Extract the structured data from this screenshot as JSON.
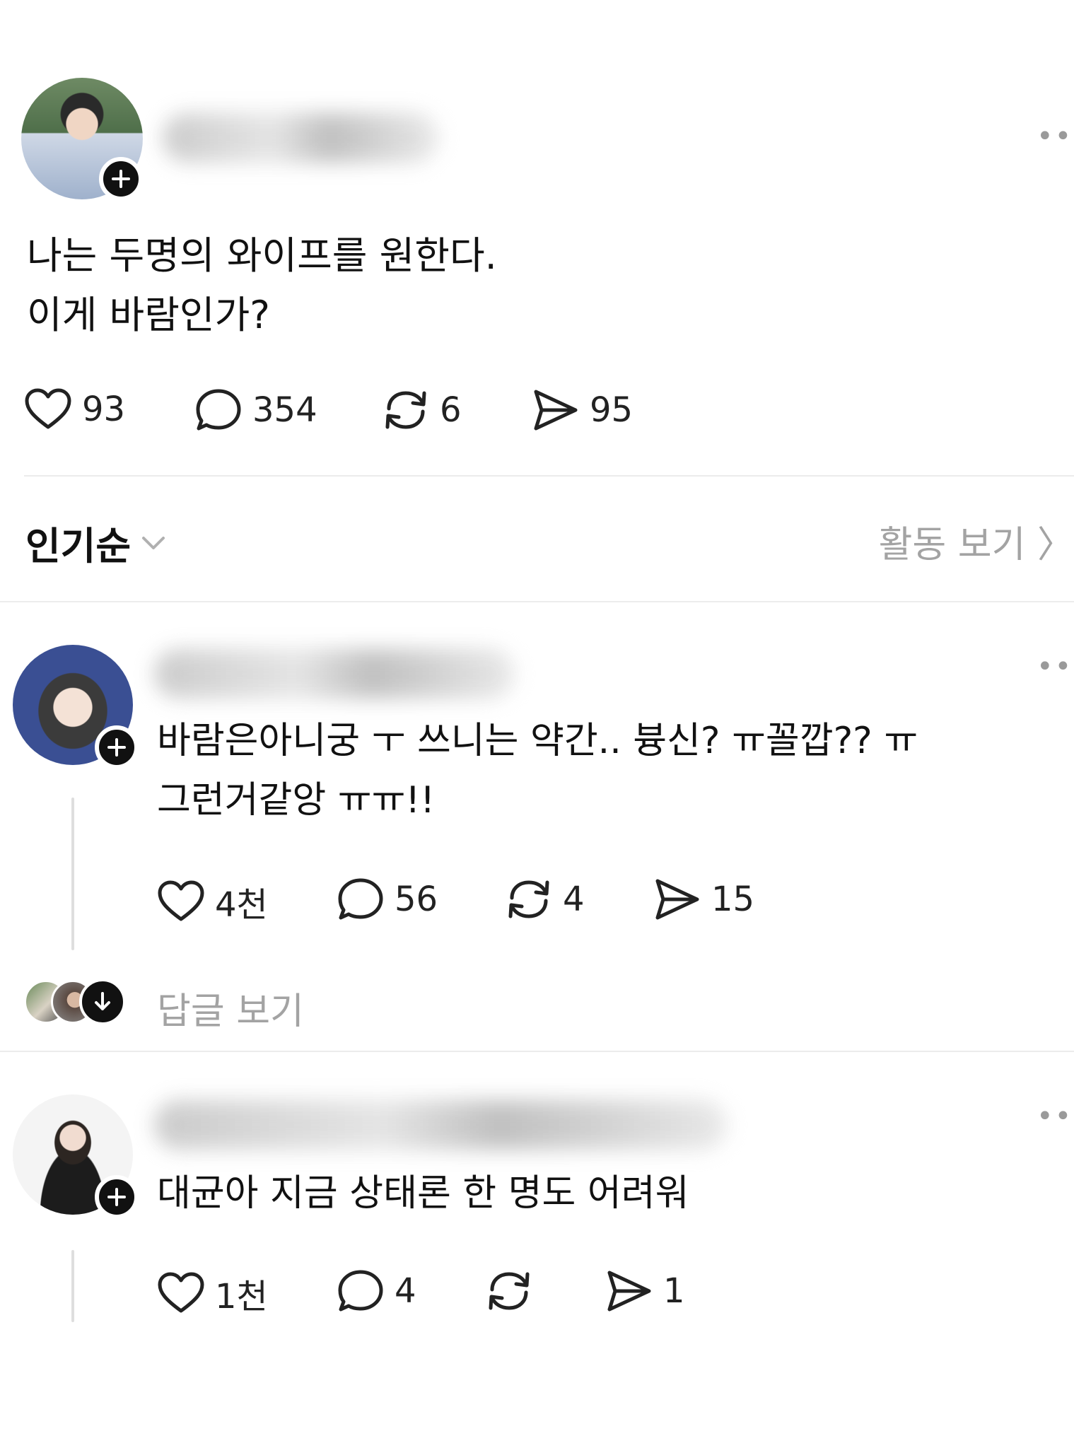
{
  "post": {
    "author_name": "",
    "text_line1": "나는 두명의 와이프를 원한다.",
    "text_line2": "이게 바람인가?",
    "actions": {
      "likes": "93",
      "comments": "354",
      "reposts": "6",
      "shares": "95"
    }
  },
  "sort": {
    "label": "인기순",
    "activity_label": "활동 보기 〉"
  },
  "comments": [
    {
      "text_line1": "바람은아니궁 ㅜ 쓰니는 약간.. 븅신? ㅠ꼴깝?? ㅠ",
      "text_line2": "그런거같앙 ㅠㅠ!!",
      "actions": {
        "likes": "4천",
        "comments": "56",
        "reposts": "4",
        "shares": "15"
      },
      "replies_label": "답글 보기"
    },
    {
      "text_line1": "대균아 지금 상태론 한 명도 어려워",
      "actions": {
        "likes": "1천",
        "comments": "4",
        "reposts": "",
        "shares": "1"
      }
    }
  ],
  "icons": {
    "follow": "plus-icon",
    "more": "more-icon",
    "like": "heart-icon",
    "comment": "comment-icon",
    "repost": "repost-icon",
    "share": "send-icon",
    "sort": "chevron-down-icon",
    "replies": "arrow-down-icon"
  }
}
